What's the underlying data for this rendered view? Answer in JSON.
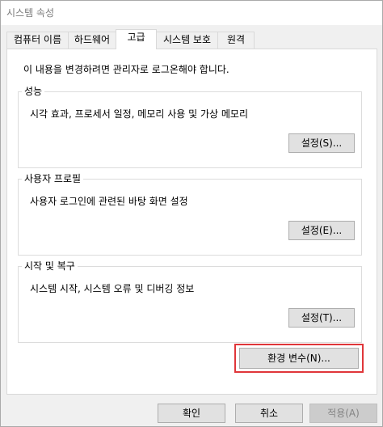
{
  "window": {
    "title": "시스템 속성"
  },
  "tabs": [
    {
      "label": "컴퓨터 이름",
      "active": false
    },
    {
      "label": "하드웨어",
      "active": false
    },
    {
      "label": "고급",
      "active": true
    },
    {
      "label": "시스템 보호",
      "active": false
    },
    {
      "label": "원격",
      "active": false
    }
  ],
  "advanced": {
    "admin_note": "이 내용을 변경하려면 관리자로 로그온해야 합니다.",
    "performance": {
      "title": "성능",
      "description": "시각 효과, 프로세서 일정, 메모리 사용 및 가상 메모리",
      "button": "설정(S)..."
    },
    "user_profiles": {
      "title": "사용자 프로필",
      "description": "사용자 로그인에 관련된 바탕 화면 설정",
      "button": "설정(E)..."
    },
    "startup_recovery": {
      "title": "시작 및 복구",
      "description": "시스템 시작, 시스템 오류 및 디버깅 정보",
      "button": "설정(T)..."
    },
    "env_vars_button": "환경 변수(N)...",
    "highlight_color": "#e0363a"
  },
  "footer": {
    "ok": "확인",
    "cancel": "취소",
    "apply": "적용(A)",
    "apply_enabled": false
  }
}
